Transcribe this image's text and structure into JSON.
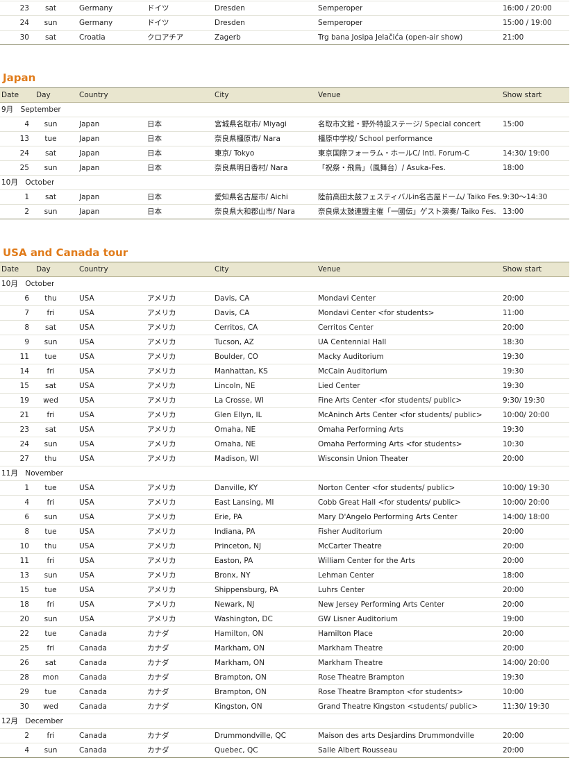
{
  "headers": {
    "date": "Date",
    "day": "Day",
    "country": "Country",
    "city": "City",
    "venue": "Venue",
    "show": "Show start"
  },
  "europe_tail": [
    {
      "date": "23",
      "day": "sat",
      "country": "Germany",
      "jp": "ドイツ",
      "city": "Dresden",
      "venue": "Semperoper",
      "show": "16:00 / 20:00"
    },
    {
      "date": "24",
      "day": "sun",
      "country": "Germany",
      "jp": "ドイツ",
      "city": "Dresden",
      "venue": "Semperoper",
      "show": "15:00 / 19:00"
    },
    {
      "date": "30",
      "day": "sat",
      "country": "Croatia",
      "jp": "クロアチア",
      "city": "Zagerb",
      "venue": "Trg bana Josipa Jelačića (open-air show)",
      "show": "21:00"
    }
  ],
  "japan": {
    "title": "Japan",
    "months": [
      {
        "label": "9月　September",
        "rows": [
          {
            "date": "4",
            "day": "sun",
            "country": "Japan",
            "jp": "日本",
            "city": "宮城県名取市/ Miyagi",
            "venue": "名取市文館・野外特設ステージ/ Special concert",
            "show": "15:00"
          },
          {
            "date": "13",
            "day": "tue",
            "country": "Japan",
            "jp": "日本",
            "city": "奈良県橿原市/ Nara",
            "venue": "橿原中学校/ School performance",
            "show": ""
          },
          {
            "date": "24",
            "day": "sat",
            "country": "Japan",
            "jp": "日本",
            "city": "東京/ Tokyo",
            "venue": "東京国際フォーラム・ホールC/ Intl. Forum-C",
            "show": "14:30/ 19:00"
          },
          {
            "date": "25",
            "day": "sun",
            "country": "Japan",
            "jp": "日本",
            "city": "奈良県明日香村/ Nara",
            "venue": "「祝祭・飛鳥」（風舞台）/ Asuka-Fes.",
            "show": "18:00"
          }
        ]
      },
      {
        "label": "10月　October",
        "rows": [
          {
            "date": "1",
            "day": "sat",
            "country": "Japan",
            "jp": "日本",
            "city": "愛知県名古屋市/ Aichi",
            "venue": "陸前高田太鼓フェスティバルin名古屋ドーム/ Taiko Fes.",
            "show": "9:30～14:30"
          },
          {
            "date": "2",
            "day": "sun",
            "country": "Japan",
            "jp": "日本",
            "city": "奈良県大和郡山市/ Nara",
            "venue": "奈良県太鼓連盟主催「一國伝」ゲスト演奏/ Taiko Fes.",
            "show": "13:00"
          }
        ]
      }
    ]
  },
  "usa": {
    "title": "USA and Canada tour",
    "months": [
      {
        "label": "10月　October",
        "rows": [
          {
            "date": "6",
            "day": "thu",
            "country": "USA",
            "jp": "アメリカ",
            "city": "Davis, CA",
            "venue": "Mondavi Center",
            "show": "20:00"
          },
          {
            "date": "7",
            "day": "fri",
            "country": "USA",
            "jp": "アメリカ",
            "city": "Davis, CA",
            "venue": "Mondavi Center <for students>",
            "show": "11:00"
          },
          {
            "date": "8",
            "day": "sat",
            "country": "USA",
            "jp": "アメリカ",
            "city": "Cerritos, CA",
            "venue": "Cerritos Center",
            "show": "20:00"
          },
          {
            "date": "9",
            "day": "sun",
            "country": "USA",
            "jp": "アメリカ",
            "city": "Tucson, AZ",
            "venue": "UA Centennial Hall",
            "show": "18:30"
          },
          {
            "date": "11",
            "day": "tue",
            "country": "USA",
            "jp": "アメリカ",
            "city": "Boulder, CO",
            "venue": "Macky Auditorium",
            "show": "19:30"
          },
          {
            "date": "14",
            "day": "fri",
            "country": "USA",
            "jp": "アメリカ",
            "city": "Manhattan, KS",
            "venue": "McCain Auditorium",
            "show": "19:30"
          },
          {
            "date": "15",
            "day": "sat",
            "country": "USA",
            "jp": "アメリカ",
            "city": "Lincoln, NE",
            "venue": "Lied Center",
            "show": "19:30"
          },
          {
            "date": "19",
            "day": "wed",
            "country": "USA",
            "jp": "アメリカ",
            "city": "La Crosse, WI",
            "venue": "Fine Arts Center <for students/ public>",
            "show": "9:30/ 19:30"
          },
          {
            "date": "21",
            "day": "fri",
            "country": "USA",
            "jp": "アメリカ",
            "city": "Glen Ellyn, IL",
            "venue": "McAninch Arts Center <for students/ public>",
            "show": "10:00/ 20:00"
          },
          {
            "date": "23",
            "day": "sat",
            "country": "USA",
            "jp": "アメリカ",
            "city": "Omaha, NE",
            "venue": "Omaha Performing Arts",
            "show": "19:30"
          },
          {
            "date": "24",
            "day": "sun",
            "country": "USA",
            "jp": "アメリカ",
            "city": "Omaha, NE",
            "venue": "Omaha Performing Arts <for students>",
            "show": "10:30"
          },
          {
            "date": "27",
            "day": "thu",
            "country": "USA",
            "jp": "アメリカ",
            "city": "Madison, WI",
            "venue": "Wisconsin Union Theater",
            "show": "20:00"
          }
        ]
      },
      {
        "label": "11月　November",
        "rows": [
          {
            "date": "1",
            "day": "tue",
            "country": "USA",
            "jp": "アメリカ",
            "city": "Danville, KY",
            "venue": "Norton Center <for students/ public>",
            "show": "10:00/ 19:30"
          },
          {
            "date": "4",
            "day": "fri",
            "country": "USA",
            "jp": "アメリカ",
            "city": "East Lansing, MI",
            "venue": "Cobb Great Hall <for students/ public>",
            "show": "10:00/ 20:00"
          },
          {
            "date": "6",
            "day": "sun",
            "country": "USA",
            "jp": "アメリカ",
            "city": "Erie, PA",
            "venue": "Mary D'Angelo Performing Arts Center",
            "show": "14:00/ 18:00"
          },
          {
            "date": "8",
            "day": "tue",
            "country": "USA",
            "jp": "アメリカ",
            "city": "Indiana, PA",
            "venue": "Fisher Auditorium",
            "show": "20:00"
          },
          {
            "date": "10",
            "day": "thu",
            "country": "USA",
            "jp": "アメリカ",
            "city": "Princeton, NJ",
            "venue": "McCarter Theatre",
            "show": "20:00"
          },
          {
            "date": "11",
            "day": "fri",
            "country": "USA",
            "jp": "アメリカ",
            "city": "Easton, PA",
            "venue": "William Center for the Arts",
            "show": "20:00"
          },
          {
            "date": "13",
            "day": "sun",
            "country": "USA",
            "jp": "アメリカ",
            "city": "Bronx, NY",
            "venue": "Lehman Center",
            "show": "18:00"
          },
          {
            "date": "15",
            "day": "tue",
            "country": "USA",
            "jp": "アメリカ",
            "city": "Shippensburg, PA",
            "venue": "Luhrs Center",
            "show": "20:00"
          },
          {
            "date": "18",
            "day": "fri",
            "country": "USA",
            "jp": "アメリカ",
            "city": "Newark, NJ",
            "venue": "New Jersey Performing Arts Center",
            "show": "20:00"
          },
          {
            "date": "20",
            "day": "sun",
            "country": "USA",
            "jp": "アメリカ",
            "city": "Washington, DC",
            "venue": "GW Lisner Auditorium",
            "show": "19:00"
          },
          {
            "date": "22",
            "day": "tue",
            "country": "Canada",
            "jp": "カナダ",
            "city": "Hamilton, ON",
            "venue": "Hamilton Place",
            "show": "20:00"
          },
          {
            "date": "25",
            "day": "fri",
            "country": "Canada",
            "jp": "カナダ",
            "city": "Markham, ON",
            "venue": "Markham Theatre",
            "show": "20:00"
          },
          {
            "date": "26",
            "day": "sat",
            "country": "Canada",
            "jp": "カナダ",
            "city": "Markham, ON",
            "venue": "Markham Theatre",
            "show": "14:00/ 20:00"
          },
          {
            "date": "28",
            "day": "mon",
            "country": "Canada",
            "jp": "カナダ",
            "city": "Brampton, ON",
            "venue": "Rose Theatre Brampton",
            "show": "19:30"
          },
          {
            "date": "29",
            "day": "tue",
            "country": "Canada",
            "jp": "カナダ",
            "city": "Brampton, ON",
            "venue": "Rose Theatre Brampton <for students>",
            "show": "10:00"
          },
          {
            "date": "30",
            "day": "wed",
            "country": "Canada",
            "jp": "カナダ",
            "city": "Kingston, ON",
            "venue": "Grand Theatre Kingston <students/ public>",
            "show": "11:30/ 19:30"
          }
        ]
      },
      {
        "label": "12月　December",
        "rows": [
          {
            "date": "2",
            "day": "fri",
            "country": "Canada",
            "jp": "カナダ",
            "city": "Drummondville, QC",
            "venue": "Maison des arts Desjardins Drummondville",
            "show": "20:00"
          },
          {
            "date": "4",
            "day": "sun",
            "country": "Canada",
            "jp": "カナダ",
            "city": "Quebec, QC",
            "venue": "Salle Albert Rousseau",
            "show": "20:00"
          }
        ]
      }
    ]
  }
}
